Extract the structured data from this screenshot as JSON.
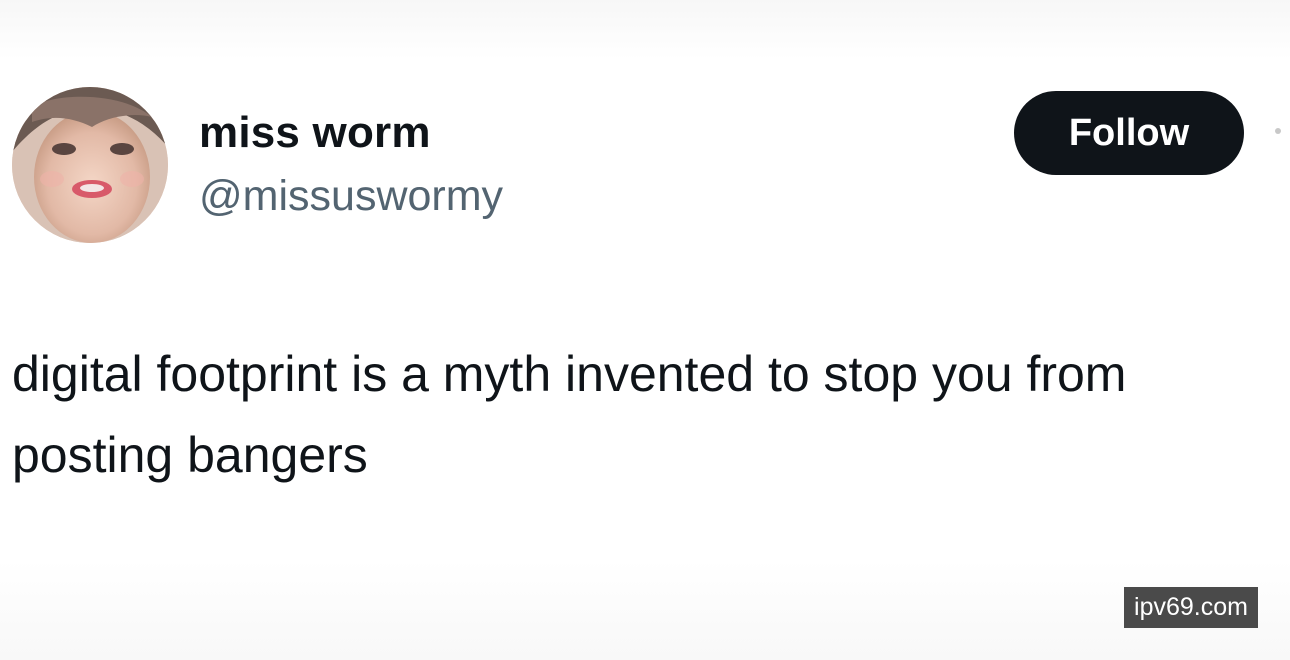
{
  "tweet": {
    "display_name": "miss worm",
    "handle": "@missuswormy",
    "follow_label": "Follow",
    "text": "digital footprint is a myth invented to stop you from posting bangers"
  },
  "watermark": {
    "text": "ipv69.com"
  },
  "colors": {
    "follow_bg": "#0f1419",
    "follow_text": "#ffffff",
    "handle": "#536471",
    "watermark_bg": "#4a4a4a"
  }
}
